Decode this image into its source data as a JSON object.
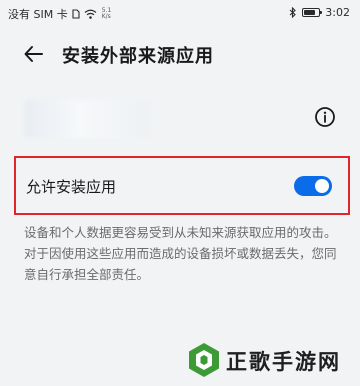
{
  "status": {
    "carrier": "没有 SIM 卡",
    "speed_value": "5.1",
    "speed_unit": "K/s",
    "time": "3:02",
    "battery_level": 0.75
  },
  "header": {
    "title": "安装外部来源应用"
  },
  "toggle": {
    "label": "允许安装应用",
    "state": "on",
    "accent_color": "#0a6ce8",
    "highlight_color": "#e0262a"
  },
  "warning_text": "设备和个人数据更容易受到从未知来源获取应用的攻击。对于因使用这些应用而造成的设备损坏或数据丢失，您同意自行承担全部责任。",
  "watermark": {
    "text": "正歌手游网"
  }
}
